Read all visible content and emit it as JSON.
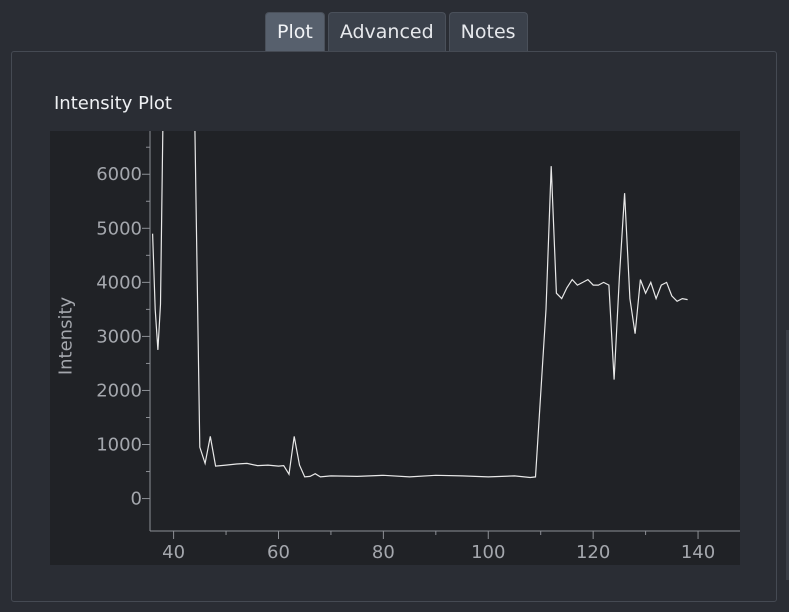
{
  "tabs": [
    {
      "label": "Plot",
      "active": true
    },
    {
      "label": "Advanced",
      "active": false
    },
    {
      "label": "Notes",
      "active": false
    }
  ],
  "panel": {
    "title": "Intensity Plot"
  },
  "colors": {
    "background": "#2a2d34",
    "plot_background": "#202226",
    "line": "#e8e8e8",
    "tab_active": "#57606d",
    "tab_inactive": "#3b414b"
  },
  "chart_data": {
    "type": "line",
    "title": "",
    "xlabel": "",
    "ylabel": "Intensity",
    "xlim": [
      35.5,
      148
    ],
    "ylim": [
      -600,
      6800
    ],
    "xticks": [
      40,
      60,
      80,
      100,
      120,
      140
    ],
    "yticks": [
      0,
      1000,
      2000,
      3000,
      4000,
      5000,
      6000
    ],
    "grid": false,
    "x": [
      36,
      36.5,
      37,
      37.5,
      38,
      44,
      45,
      46,
      47,
      48,
      50,
      52,
      54,
      56,
      58,
      60,
      61,
      62,
      63,
      64,
      65,
      66,
      67,
      68,
      70,
      75,
      80,
      85,
      90,
      95,
      100,
      105,
      108,
      109,
      111,
      112,
      113,
      114,
      115,
      116,
      117,
      118,
      119,
      120,
      121,
      122,
      123,
      124,
      125,
      126,
      127,
      128,
      129,
      130,
      131,
      132,
      133,
      134,
      135,
      136,
      137,
      138
    ],
    "y": [
      4900,
      3500,
      2750,
      3600,
      7200,
      7200,
      950,
      650,
      1150,
      600,
      620,
      640,
      650,
      610,
      620,
      600,
      610,
      450,
      1150,
      620,
      400,
      410,
      460,
      400,
      420,
      410,
      430,
      400,
      430,
      420,
      400,
      420,
      390,
      400,
      3500,
      6150,
      3800,
      3700,
      3900,
      4050,
      3950,
      4000,
      4050,
      3950,
      3950,
      4000,
      3950,
      2200,
      4100,
      5650,
      3700,
      3050,
      4050,
      3800,
      4000,
      3700,
      3950,
      4000,
      3750,
      3650,
      3700,
      3680
    ]
  }
}
